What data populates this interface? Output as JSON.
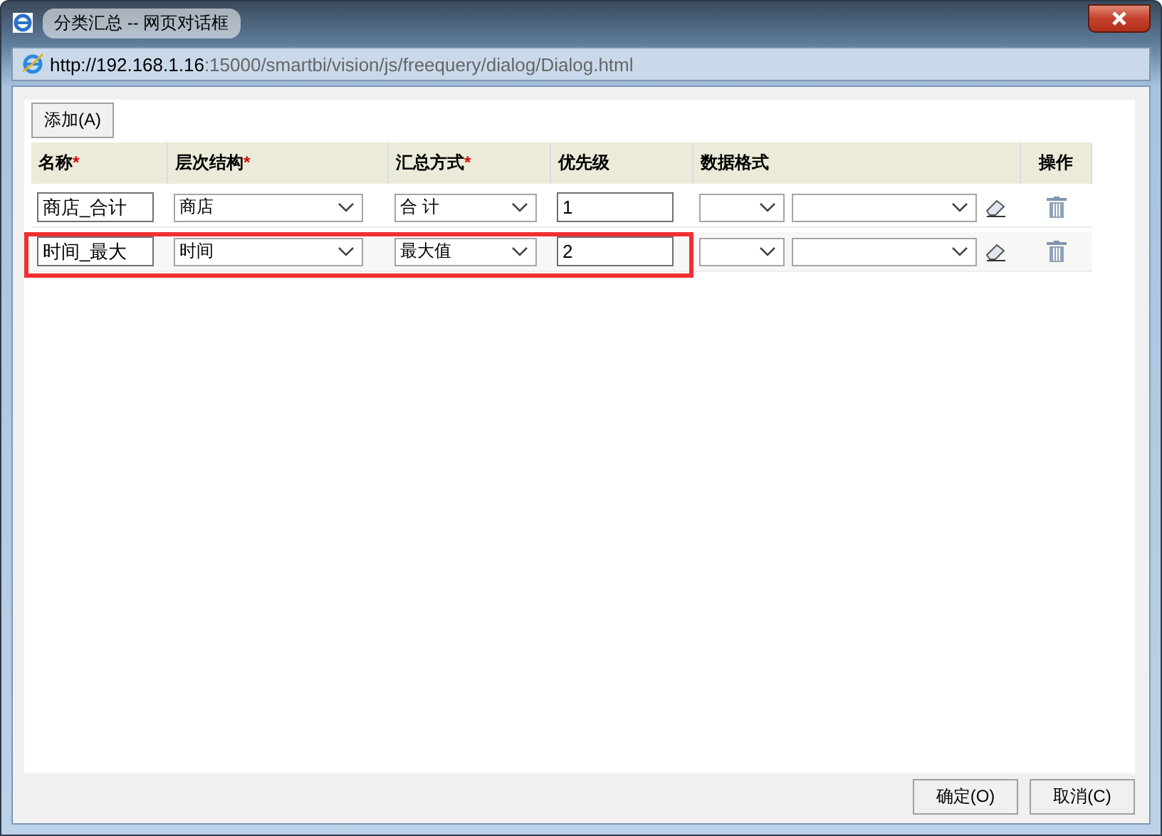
{
  "window": {
    "title": "分类汇总 -- 网页对话框"
  },
  "address_bar": {
    "host": "http://192.168.1.16",
    "rest": ":15000/smartbi/vision/js/freequery/dialog/Dialog.html"
  },
  "toolbar": {
    "add_button": "添加(A)"
  },
  "table": {
    "columns": [
      {
        "label": "名称",
        "required_mark": "*"
      },
      {
        "label": "层次结构",
        "required_mark": "*"
      },
      {
        "label": "汇总方式",
        "required_mark": "*"
      },
      {
        "label": "优先级"
      },
      {
        "label": "数据格式"
      },
      {
        "label": "操作"
      }
    ],
    "rows": [
      {
        "name": "商店_合计",
        "hierarchy": "商店",
        "summary": "合 计",
        "priority": "1",
        "highlighted": false
      },
      {
        "name": "时间_最大",
        "hierarchy": "时间",
        "summary": "最大值",
        "priority": "2",
        "highlighted": true
      }
    ]
  },
  "buttons": [
    "确定(O)",
    "取消(C)"
  ]
}
